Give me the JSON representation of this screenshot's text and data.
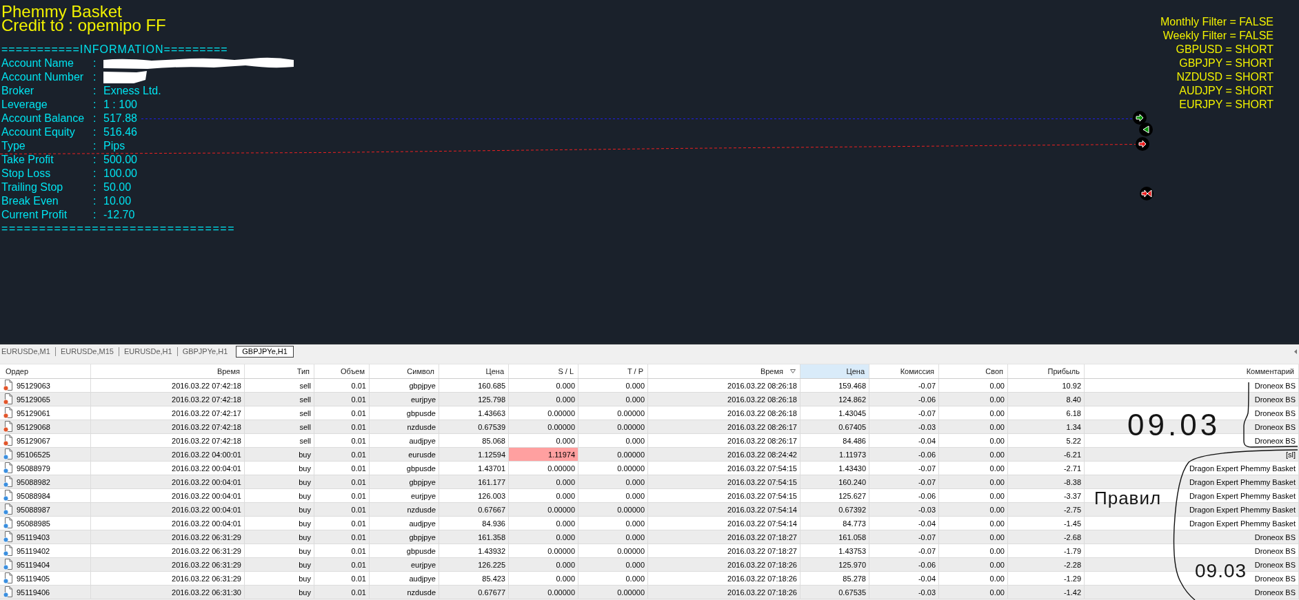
{
  "chart": {
    "title": "Phemmy Basket",
    "credit": "Credit to : opemipo FF",
    "info_header": "===========INFORMATION=========",
    "info": [
      {
        "label": "Account Name",
        "colon": ":",
        "redacted": true
      },
      {
        "label": "Account Number",
        "colon": ":",
        "redacted": true
      },
      {
        "label": "Broker",
        "colon": ":",
        "value": "Exness Ltd.",
        "redacted": false
      },
      {
        "label": "Leverage",
        "colon": ":",
        "value": "1 : 100",
        "redacted": false
      },
      {
        "label": "Account Balance",
        "colon": ":",
        "value": "517.88",
        "redacted": false
      },
      {
        "label": "Account Equity",
        "colon": ":",
        "value": "516.46",
        "redacted": false
      },
      {
        "label": "Type",
        "colon": ":",
        "value": "Pips",
        "redacted": false
      },
      {
        "label": "Take Profit",
        "colon": ":",
        "value": "500.00",
        "redacted": false
      },
      {
        "label": "Stop Loss",
        "colon": ":",
        "value": "100.00",
        "redacted": false
      },
      {
        "label": "Trailing Stop",
        "colon": ":",
        "value": "50.00",
        "redacted": false
      },
      {
        "label": "Break Even",
        "colon": ":",
        "value": "10.00",
        "redacted": false
      },
      {
        "label": "Current Profit",
        "colon": ":",
        "value": "-12.70",
        "redacted": false
      }
    ],
    "info_footer": "===============================",
    "signals": [
      "Monthly Filter = FALSE",
      "Weekly Filter = FALSE",
      "GBPUSD = SHORT",
      "GBPJPY = SHORT",
      "NZDUSD = SHORT",
      "AUDJPY = SHORT",
      "EURJPY = SHORT"
    ]
  },
  "chart_tabs": [
    {
      "label": "EURUSDe,M1",
      "selected": false
    },
    {
      "label": "EURUSDe,M15",
      "selected": false
    },
    {
      "label": "EURUSDe,H1",
      "selected": false
    },
    {
      "label": "GBPJPYe,H1",
      "selected": false
    },
    {
      "label": "GBPJPYe,H1",
      "selected": true
    }
  ],
  "table": {
    "columns": [
      {
        "label": "Ордер",
        "sorted": false,
        "highlighted": false
      },
      {
        "label": "Время",
        "sorted": false,
        "highlighted": false
      },
      {
        "label": "Тип",
        "sorted": false,
        "highlighted": false
      },
      {
        "label": "Объем",
        "sorted": false,
        "highlighted": false
      },
      {
        "label": "Символ",
        "sorted": false,
        "highlighted": false
      },
      {
        "label": "Цена",
        "sorted": false,
        "highlighted": false
      },
      {
        "label": "S / L",
        "sorted": false,
        "highlighted": false
      },
      {
        "label": "T / P",
        "sorted": false,
        "highlighted": false
      },
      {
        "label": "Время",
        "sorted": true,
        "highlighted": false
      },
      {
        "label": "Цена",
        "sorted": false,
        "highlighted": true
      },
      {
        "label": "Комиссия",
        "sorted": false,
        "highlighted": false
      },
      {
        "label": "Своп",
        "sorted": false,
        "highlighted": false
      },
      {
        "label": "Прибыль",
        "sorted": false,
        "highlighted": false
      },
      {
        "label": "Комментарий",
        "sorted": false,
        "highlighted": false
      }
    ],
    "rows": [
      {
        "kind": "sell",
        "sl_highlighted": false,
        "cells": [
          "95129063",
          "2016.03.22 07:42:18",
          "sell",
          "0.01",
          "gbpjpye",
          "160.685",
          "0.000",
          "0.000",
          "2016.03.22 08:26:18",
          "159.468",
          "-0.07",
          "0.00",
          "10.92",
          "Droneox BS"
        ]
      },
      {
        "kind": "sell",
        "sl_highlighted": false,
        "cells": [
          "95129065",
          "2016.03.22 07:42:18",
          "sell",
          "0.01",
          "eurjpye",
          "125.798",
          "0.000",
          "0.000",
          "2016.03.22 08:26:18",
          "124.862",
          "-0.06",
          "0.00",
          "8.40",
          "Droneox BS"
        ]
      },
      {
        "kind": "sell",
        "sl_highlighted": false,
        "cells": [
          "95129061",
          "2016.03.22 07:42:17",
          "sell",
          "0.01",
          "gbpusde",
          "1.43663",
          "0.00000",
          "0.00000",
          "2016.03.22 08:26:18",
          "1.43045",
          "-0.07",
          "0.00",
          "6.18",
          "Droneox BS"
        ]
      },
      {
        "kind": "sell",
        "sl_highlighted": false,
        "cells": [
          "95129068",
          "2016.03.22 07:42:18",
          "sell",
          "0.01",
          "nzdusde",
          "0.67539",
          "0.00000",
          "0.00000",
          "2016.03.22 08:26:17",
          "0.67405",
          "-0.03",
          "0.00",
          "1.34",
          "Droneox BS"
        ]
      },
      {
        "kind": "sell",
        "sl_highlighted": false,
        "cells": [
          "95129067",
          "2016.03.22 07:42:18",
          "sell",
          "0.01",
          "audjpye",
          "85.068",
          "0.000",
          "0.000",
          "2016.03.22 08:26:17",
          "84.486",
          "-0.04",
          "0.00",
          "5.22",
          "Droneox BS"
        ]
      },
      {
        "kind": "buy",
        "sl_highlighted": true,
        "cells": [
          "95106525",
          "2016.03.22 04:00:01",
          "buy",
          "0.01",
          "eurusde",
          "1.12594",
          "1.11974",
          "0.00000",
          "2016.03.22 08:24:42",
          "1.11973",
          "-0.06",
          "0.00",
          "-6.21",
          "[sl]"
        ]
      },
      {
        "kind": "buy",
        "sl_highlighted": false,
        "cells": [
          "95088979",
          "2016.03.22 00:04:01",
          "buy",
          "0.01",
          "gbpusde",
          "1.43701",
          "0.00000",
          "0.00000",
          "2016.03.22 07:54:15",
          "1.43430",
          "-0.07",
          "0.00",
          "-2.71",
          "Dragon Expert Phemmy Basket"
        ]
      },
      {
        "kind": "buy",
        "sl_highlighted": false,
        "cells": [
          "95088982",
          "2016.03.22 00:04:01",
          "buy",
          "0.01",
          "gbpjpye",
          "161.177",
          "0.000",
          "0.000",
          "2016.03.22 07:54:15",
          "160.240",
          "-0.07",
          "0.00",
          "-8.38",
          "Dragon Expert Phemmy Basket"
        ]
      },
      {
        "kind": "buy",
        "sl_highlighted": false,
        "cells": [
          "95088984",
          "2016.03.22 00:04:01",
          "buy",
          "0.01",
          "eurjpye",
          "126.003",
          "0.000",
          "0.000",
          "2016.03.22 07:54:15",
          "125.627",
          "-0.06",
          "0.00",
          "-3.37",
          "Dragon Expert Phemmy Basket"
        ]
      },
      {
        "kind": "buy",
        "sl_highlighted": false,
        "cells": [
          "95088987",
          "2016.03.22 00:04:01",
          "buy",
          "0.01",
          "nzdusde",
          "0.67667",
          "0.00000",
          "0.00000",
          "2016.03.22 07:54:14",
          "0.67392",
          "-0.03",
          "0.00",
          "-2.75",
          "Dragon Expert Phemmy Basket"
        ]
      },
      {
        "kind": "buy",
        "sl_highlighted": false,
        "cells": [
          "95088985",
          "2016.03.22 00:04:01",
          "buy",
          "0.01",
          "audjpye",
          "84.936",
          "0.000",
          "0.000",
          "2016.03.22 07:54:14",
          "84.773",
          "-0.04",
          "0.00",
          "-1.45",
          "Dragon Expert Phemmy Basket"
        ]
      },
      {
        "kind": "buy",
        "sl_highlighted": false,
        "cells": [
          "95119403",
          "2016.03.22 06:31:29",
          "buy",
          "0.01",
          "gbpjpye",
          "161.358",
          "0.000",
          "0.000",
          "2016.03.22 07:18:27",
          "161.058",
          "-0.07",
          "0.00",
          "-2.68",
          "Droneox BS"
        ]
      },
      {
        "kind": "buy",
        "sl_highlighted": false,
        "cells": [
          "95119402",
          "2016.03.22 06:31:29",
          "buy",
          "0.01",
          "gbpusde",
          "1.43932",
          "0.00000",
          "0.00000",
          "2016.03.22 07:18:27",
          "1.43753",
          "-0.07",
          "0.00",
          "-1.79",
          "Droneox BS"
        ]
      },
      {
        "kind": "buy",
        "sl_highlighted": false,
        "cells": [
          "95119404",
          "2016.03.22 06:31:29",
          "buy",
          "0.01",
          "eurjpye",
          "126.225",
          "0.000",
          "0.000",
          "2016.03.22 07:18:26",
          "125.970",
          "-0.06",
          "0.00",
          "-2.28",
          "Droneox BS"
        ]
      },
      {
        "kind": "buy",
        "sl_highlighted": false,
        "cells": [
          "95119405",
          "2016.03.22 06:31:29",
          "buy",
          "0.01",
          "audjpye",
          "85.423",
          "0.000",
          "0.000",
          "2016.03.22 07:18:26",
          "85.278",
          "-0.04",
          "0.00",
          "-1.29",
          "Droneox BS"
        ]
      },
      {
        "kind": "buy",
        "sl_highlighted": false,
        "cells": [
          "95119406",
          "2016.03.22 06:31:30",
          "buy",
          "0.01",
          "nzdusde",
          "0.67677",
          "0.00000",
          "0.00000",
          "2016.03.22 07:18:26",
          "0.67535",
          "-0.03",
          "0.00",
          "-1.42",
          "Droneox BS"
        ]
      }
    ]
  },
  "handwritten_notes": [
    {
      "text": "09.03"
    },
    {
      "text": "Правил"
    },
    {
      "text": "09.03"
    }
  ]
}
